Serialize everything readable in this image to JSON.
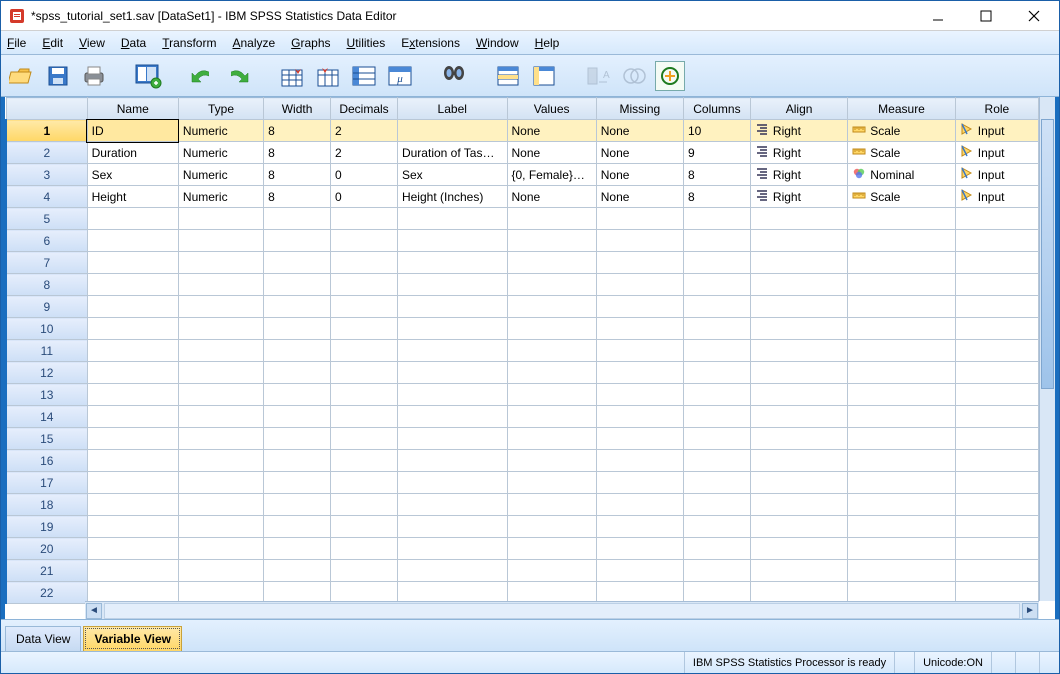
{
  "window": {
    "title": "*spss_tutorial_set1.sav [DataSet1] - IBM SPSS Statistics Data Editor"
  },
  "menu": {
    "file": "File",
    "edit": "Edit",
    "view": "View",
    "data": "Data",
    "transform": "Transform",
    "analyze": "Analyze",
    "graphs": "Graphs",
    "utilities": "Utilities",
    "extensions": "Extensions",
    "window": "Window",
    "help": "Help"
  },
  "columns": [
    "Name",
    "Type",
    "Width",
    "Decimals",
    "Label",
    "Values",
    "Missing",
    "Columns",
    "Align",
    "Measure",
    "Role"
  ],
  "rows": [
    {
      "n": 1,
      "Name": "ID",
      "Type": "Numeric",
      "Width": "8",
      "Decimals": "2",
      "Label": "",
      "Values": "None",
      "Missing": "None",
      "Columns": "10",
      "Align": "Right",
      "Measure": "Scale",
      "Role": "Input"
    },
    {
      "n": 2,
      "Name": "Duration",
      "Type": "Numeric",
      "Width": "8",
      "Decimals": "2",
      "Label": "Duration of Tas…",
      "Values": "None",
      "Missing": "None",
      "Columns": "9",
      "Align": "Right",
      "Measure": "Scale",
      "Role": "Input"
    },
    {
      "n": 3,
      "Name": "Sex",
      "Type": "Numeric",
      "Width": "8",
      "Decimals": "0",
      "Label": "Sex",
      "Values": "{0, Female}…",
      "Missing": "None",
      "Columns": "8",
      "Align": "Right",
      "Measure": "Nominal",
      "Role": "Input"
    },
    {
      "n": 4,
      "Name": "Height",
      "Type": "Numeric",
      "Width": "8",
      "Decimals": "0",
      "Label": "Height (Inches)",
      "Values": "None",
      "Missing": "None",
      "Columns": "8",
      "Align": "Right",
      "Measure": "Scale",
      "Role": "Input"
    }
  ],
  "empty_rows": [
    5,
    6,
    7,
    8,
    9,
    10,
    11,
    12,
    13,
    14,
    15,
    16,
    17,
    18,
    19,
    20,
    21,
    22
  ],
  "tabs": {
    "data_view": "Data View",
    "variable_view": "Variable View"
  },
  "status": {
    "processor": "IBM SPSS Statistics Processor is ready",
    "unicode": "Unicode:ON"
  },
  "icons": {
    "align": "align-right-icon",
    "scale": "ruler-icon",
    "nominal": "venn-icon",
    "role": "input-arrow-icon"
  }
}
